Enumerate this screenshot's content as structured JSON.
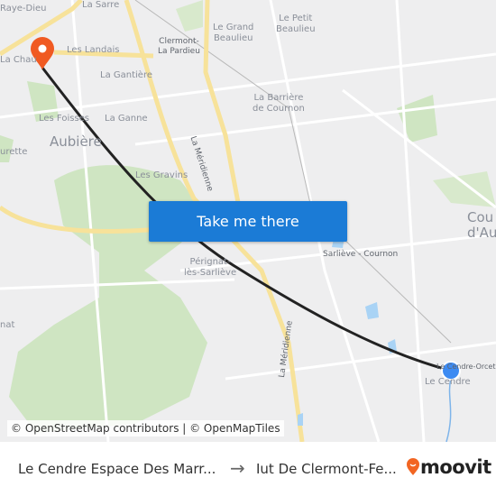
{
  "map": {
    "labels": {
      "raye_dieu": "Raye-Dieu",
      "la_sarre": "La Sarre",
      "la_chau": "La Chau",
      "les_landais": "Les Landais",
      "la_gantiere": "La Gantière",
      "clermont_pardieu": "Clermont-\nLa Pardieu",
      "le_grand_beaulieu": "Le Grand\nBeaulieu",
      "le_petit_beaulieu": "Le Petit\nBeaulieu",
      "la_barriere": "La Barrière\nde Cournon",
      "les_foisses": "Les Foisses",
      "la_ganne": "La Ganne",
      "aubiere": "Aubière",
      "urette": "urette",
      "les_gravins": "Les Gravins",
      "la_meridienne_1": "La Méridienne",
      "la_meridienne_2": "La Méridienne",
      "perignat": "Pérignat-\nlès-Sarliève",
      "sarlieve": "Sarliève - Cournon",
      "cournon": "Cou\nd'Au",
      "nat": "nat",
      "le_cendre_orcet": "Le Cendre-Orcet",
      "le_cendre": "Le Cendre"
    },
    "route_color": "#222222",
    "destination_pin_color": "#f05a22",
    "origin_dot_color": "#3d8bf2"
  },
  "cta": {
    "label": "Take me there",
    "color": "#1b7bd6"
  },
  "attribution": "© OpenStreetMap contributors | © OpenMapTiles",
  "footer": {
    "from": "Le Cendre Espace Des Marr...",
    "arrow": "→",
    "to": "Iut De Clermont-Fe...",
    "logo": "moovit",
    "logo_color": "#f26522"
  }
}
